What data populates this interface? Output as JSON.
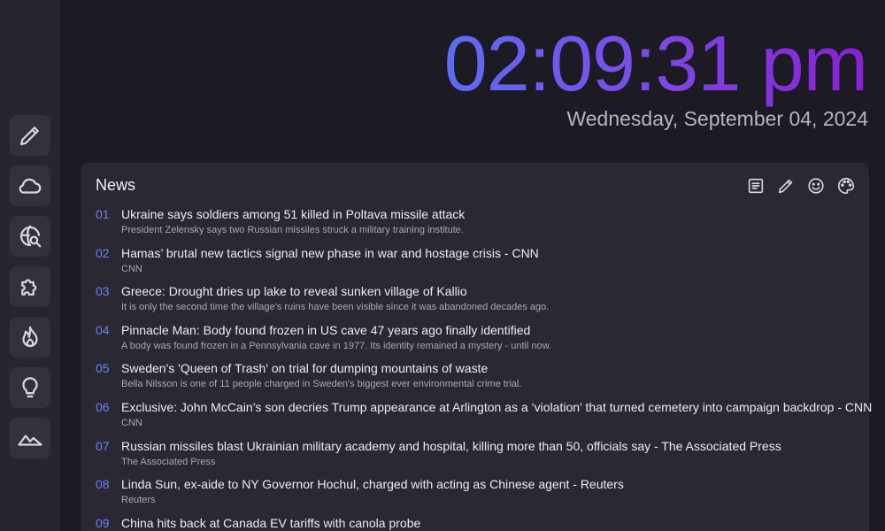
{
  "clock": {
    "time": "02:09:31 pm",
    "date": "Wednesday, September 04, 2024",
    "gradient_colors": [
      "#5d6cf2",
      "#7b4de8",
      "#8a1fd6"
    ]
  },
  "sidebar": {
    "items": [
      {
        "icon": "pencil-icon"
      },
      {
        "icon": "cloud-icon"
      },
      {
        "icon": "globe-search-icon"
      },
      {
        "icon": "puzzle-icon"
      },
      {
        "icon": "flame-icon"
      },
      {
        "icon": "lightbulb-icon"
      },
      {
        "icon": "mountain-icon"
      }
    ]
  },
  "news": {
    "title": "News",
    "toolbar_icons": [
      "article-icon",
      "pencil-icon",
      "smiley-icon",
      "palette-icon"
    ],
    "items": [
      {
        "num": "01",
        "headline": "Ukraine says soldiers among 51 killed in Poltava missile attack",
        "summary": "President Zelensky says two Russian missiles struck a military training institute."
      },
      {
        "num": "02",
        "headline": "Hamas’ brutal new tactics signal new phase in war and hostage crisis - CNN",
        "summary": "CNN"
      },
      {
        "num": "03",
        "headline": "Greece: Drought dries up lake to reveal sunken village of Kallio",
        "summary": "It is only the second time the village's ruins have been visible since it was abandoned decades ago."
      },
      {
        "num": "04",
        "headline": "Pinnacle Man: Body found frozen in US cave 47 years ago finally identified",
        "summary": "A body was found frozen in a Pennsylvania cave in 1977. Its identity remained a mystery - until now."
      },
      {
        "num": "05",
        "headline": "Sweden's 'Queen of Trash' on trial for dumping mountains of waste",
        "summary": "Bella Nilsson is one of 11 people charged in Sweden's biggest ever environmental crime trial."
      },
      {
        "num": "06",
        "headline": "Exclusive: John McCain’s son decries Trump appearance at Arlington as a ‘violation’ that turned cemetery into campaign backdrop - CNN",
        "summary": "CNN"
      },
      {
        "num": "07",
        "headline": "Russian missiles blast Ukrainian military academy and hospital, killing more than 50, officials say - The Associated Press",
        "summary": "The Associated Press"
      },
      {
        "num": "08",
        "headline": "Linda Sun, ex-aide to NY Governor Hochul, charged with acting as Chinese agent - Reuters",
        "summary": "Reuters"
      },
      {
        "num": "09",
        "headline": "China hits back at Canada EV tariffs with canola probe",
        "summary": ""
      }
    ]
  }
}
